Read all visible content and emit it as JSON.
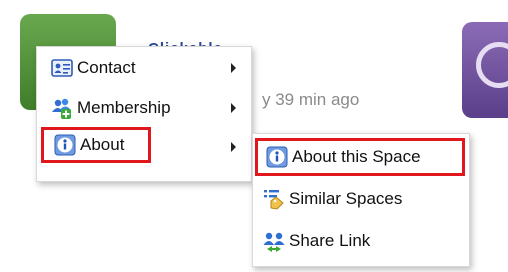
{
  "background": {
    "title": "Clickable",
    "time_text": "y 39 min ago"
  },
  "menu": {
    "items": [
      {
        "label": "Contact",
        "icon": "contact-card-icon"
      },
      {
        "label": "Membership",
        "icon": "add-people-icon"
      },
      {
        "label": "About",
        "icon": "info-icon"
      }
    ]
  },
  "submenu": {
    "items": [
      {
        "label": "About this Space",
        "icon": "info-icon"
      },
      {
        "label": "Similar Spaces",
        "icon": "list-tag-icon"
      },
      {
        "label": "Share Link",
        "icon": "share-people-icon"
      }
    ]
  },
  "colors": {
    "highlight_border": "#e0171c",
    "title_blue": "#2b4a9b"
  }
}
